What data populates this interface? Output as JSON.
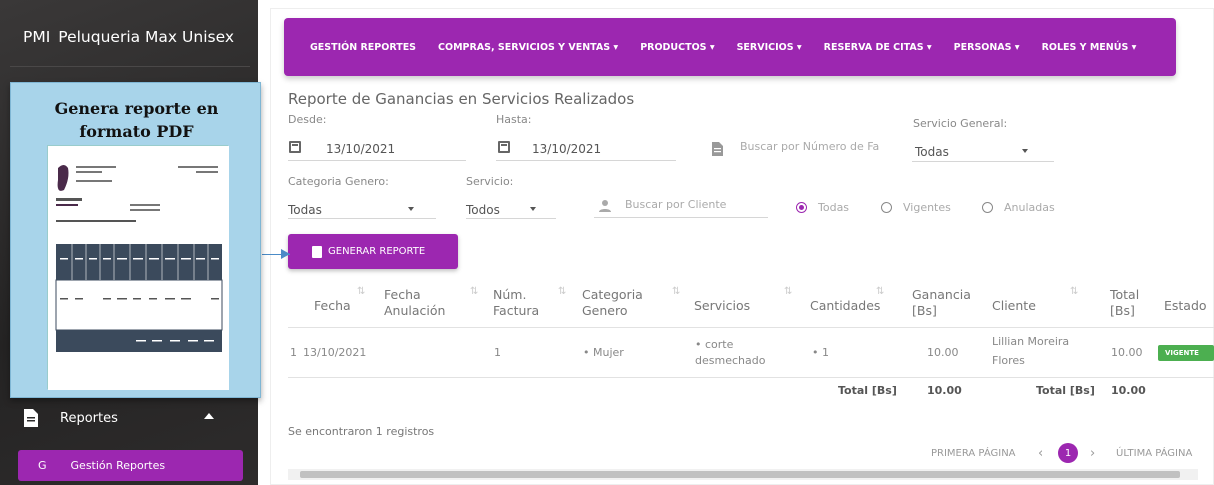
{
  "sidebar": {
    "brand_short": "PMI",
    "brand_name": "Peluqueria Max Unisex",
    "reportes_label": "Reportes",
    "sub_initial": "G",
    "sub_label": "Gestión Reportes"
  },
  "nav": {
    "items": [
      "GESTIÓN REPORTES",
      "COMPRAS, SERVICIOS Y VENTAS ▾",
      "PRODUCTOS ▾",
      "SERVICIOS ▾",
      "RESERVA DE CITAS ▾",
      "PERSONAS ▾",
      "ROLES Y MENÚS ▾"
    ]
  },
  "report": {
    "title": "Reporte de Ganancias en Servicios Realizados",
    "desde_label": "Desde:",
    "desde_value": "13/10/2021",
    "hasta_label": "Hasta:",
    "hasta_value": "13/10/2021",
    "factura_placeholder": "Buscar por Número de Fa",
    "servicio_general_label": "Servicio General:",
    "servicio_general_value": "Todas",
    "categoria_label": "Categoria Genero:",
    "categoria_value": "Todas",
    "servicio_label": "Servicio:",
    "servicio_value": "Todos",
    "cliente_placeholder": "Buscar por Cliente",
    "radio_todas": "Todas",
    "radio_vigentes": "Vigentes",
    "radio_anuladas": "Anuladas",
    "generate_button": "GENERAR REPORTE"
  },
  "table": {
    "headers": [
      "Fecha",
      "Fecha Anulación",
      "Núm. Factura",
      "Categoria Genero",
      "Servicios",
      "Cantidades",
      "Ganancia [Bs]",
      "Cliente",
      "Total [Bs]",
      "Estado"
    ],
    "row": {
      "index": "1",
      "fecha": "13/10/2021",
      "factura": "1",
      "categoria": "• Mujer",
      "servicio_line1": "• corte",
      "servicio_line2": "desmechado",
      "cantidad": "• 1",
      "ganancia": "10.00",
      "cliente_line1": "Lillian Moreira",
      "cliente_line2": "Flores",
      "total": "10.00",
      "estado": "VIGENTE"
    },
    "totals": {
      "label1": "Total [Bs]",
      "value1": "10.00",
      "label2": "Total [Bs]",
      "value2": "10.00"
    },
    "records_text": "Se encontraron 1 registros"
  },
  "pagination": {
    "first": "PRIMERA PÁGINA",
    "page": "1",
    "last": "ÚLTIMA PÁGINA"
  },
  "callout": {
    "line1": "Genera reporte en",
    "line2": "formato PDF"
  },
  "colors": {
    "accent": "#9c27b0",
    "sidebar_bg": "#2c2b2b",
    "callout_bg": "#a8d4ea",
    "badge": "#4caf50"
  }
}
